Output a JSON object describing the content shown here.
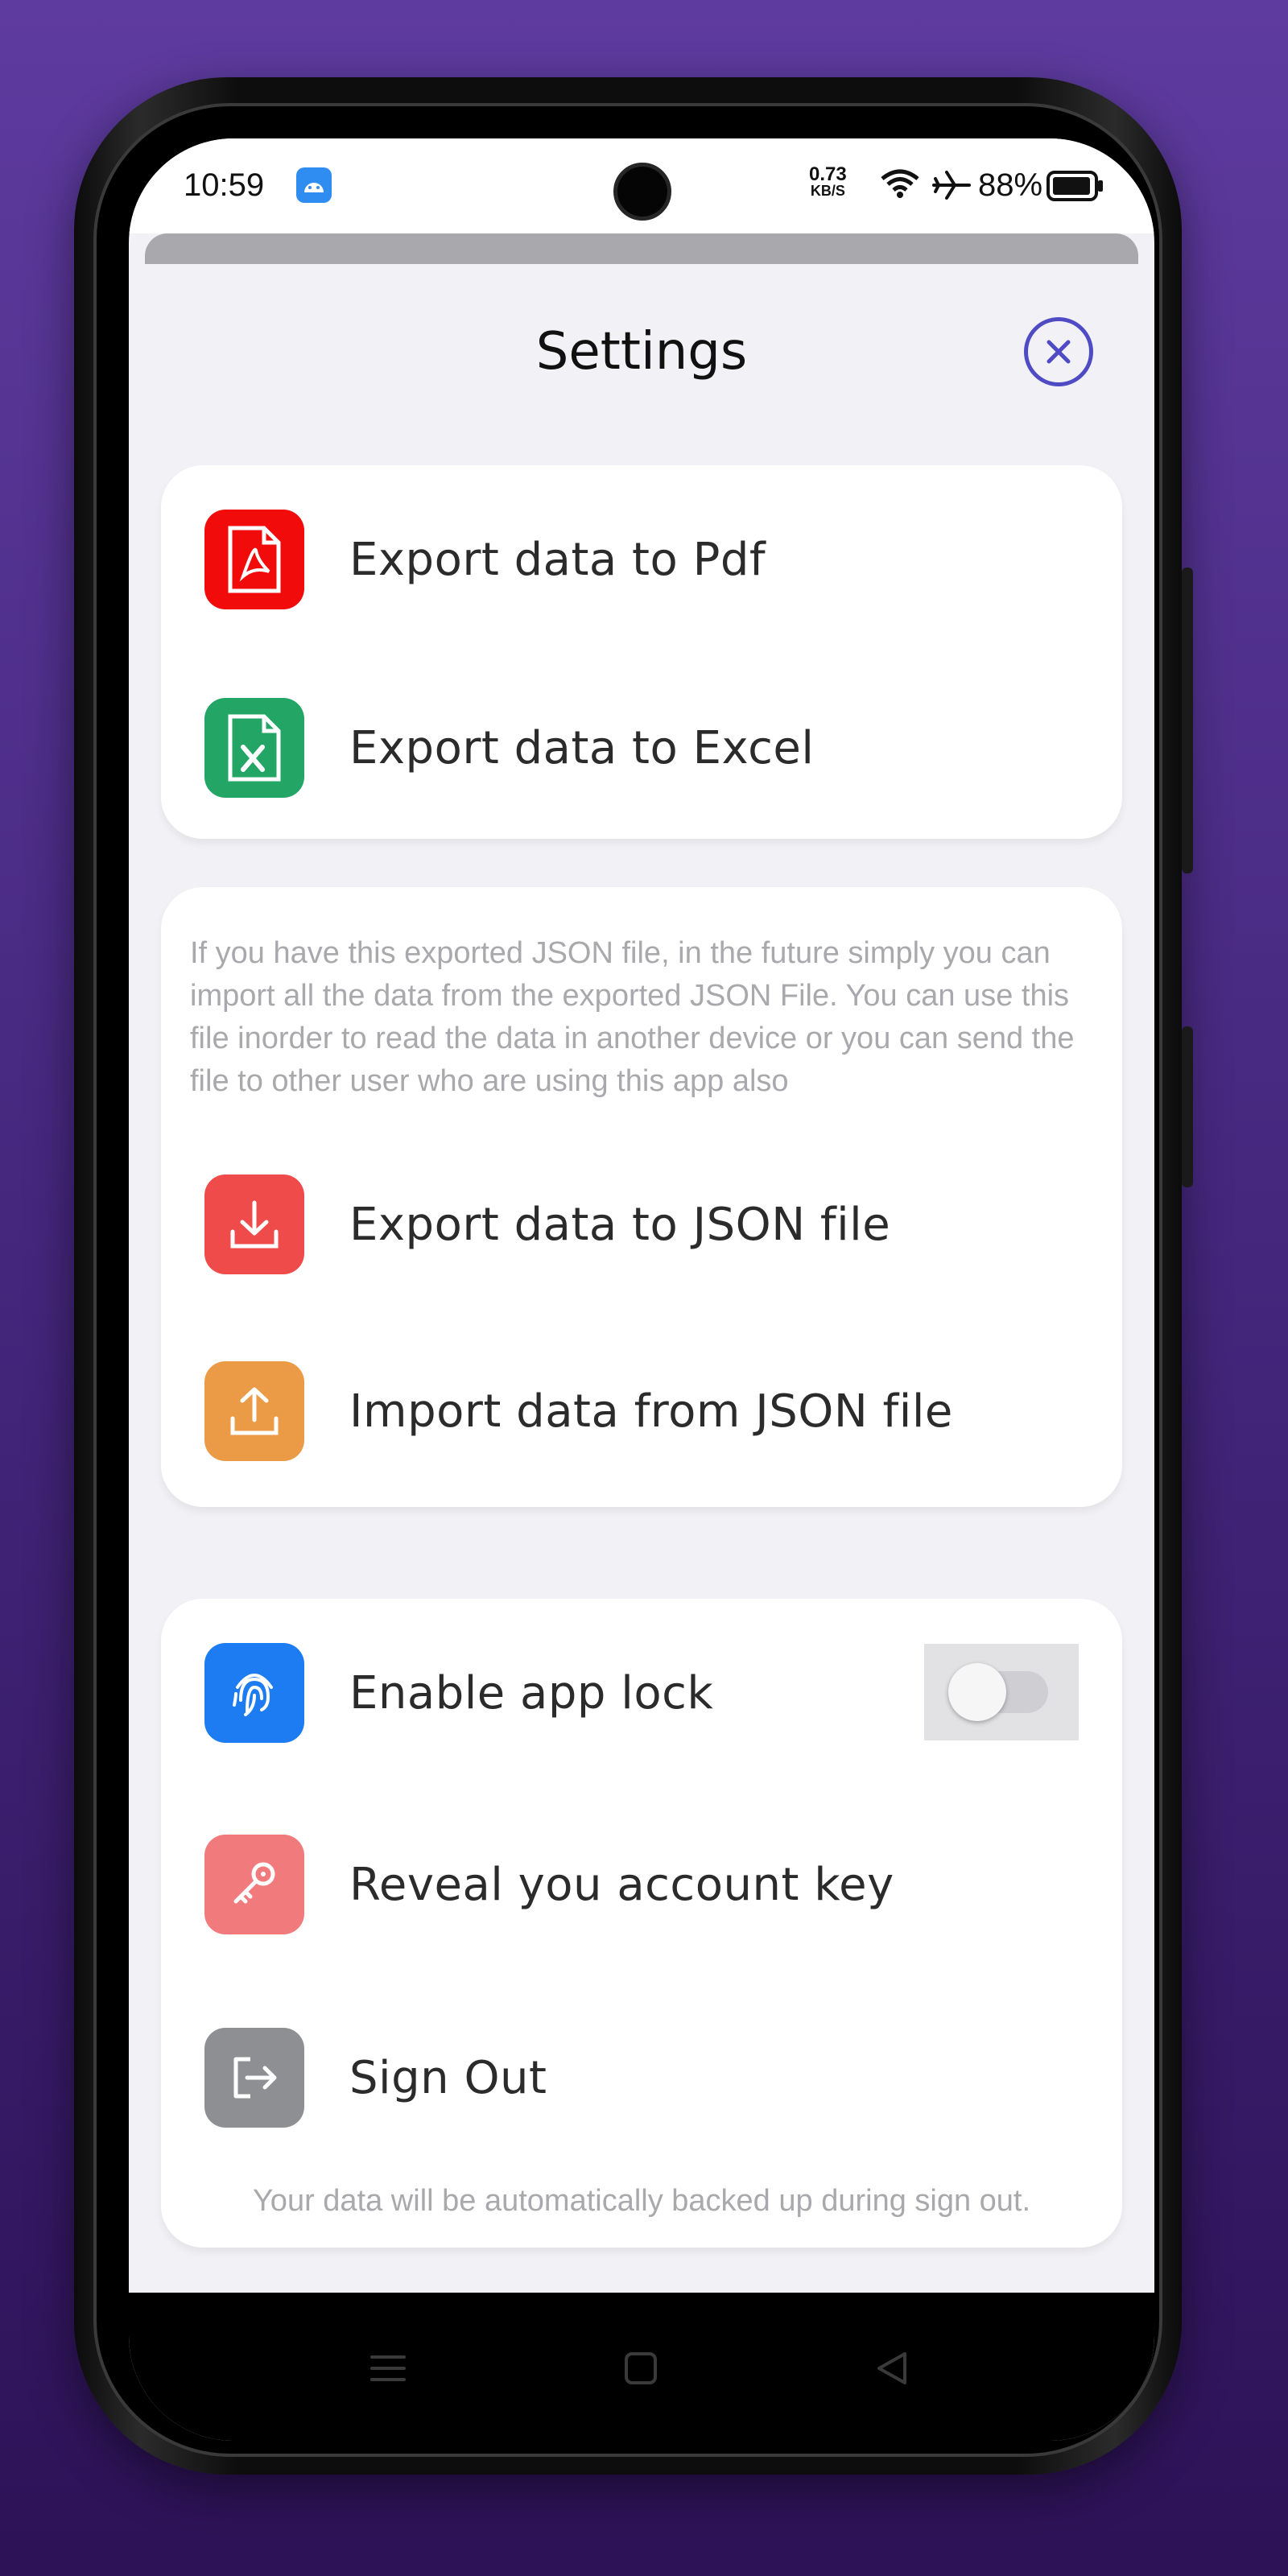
{
  "status_bar": {
    "time": "10:59",
    "net_speed_value": "0.73",
    "net_speed_unit": "KB/S",
    "battery": "88%",
    "icons": [
      "android-app-icon",
      "wifi-icon",
      "airplane-icon",
      "battery-icon"
    ]
  },
  "sheet": {
    "title": "Settings",
    "close_icon": "close-icon"
  },
  "export_section": {
    "items": [
      {
        "label": "Export data to Pdf",
        "icon": "pdf-icon",
        "color": "#f20b0b"
      },
      {
        "label": "Export data to Excel",
        "icon": "excel-icon",
        "color": "#23a566"
      }
    ]
  },
  "json_section": {
    "info": "If you have this exported JSON file, in the future simply you can import all the data from the exported JSON File. You can use this file inorder to read the data in another device or you can send the file to other user who are using this app also",
    "items": [
      {
        "label": "Export data to JSON file",
        "icon": "download-icon",
        "color": "#ef4b4b"
      },
      {
        "label": "Import data from JSON file",
        "icon": "upload-icon",
        "color": "#eb9a46"
      }
    ]
  },
  "account_section": {
    "items": [
      {
        "label": "Enable app lock",
        "icon": "fingerprint-icon",
        "color": "#1d7cf2"
      },
      {
        "label": "Reveal you account key",
        "icon": "key-icon",
        "color": "#f07a7c"
      },
      {
        "label": "Sign Out",
        "icon": "sign-out-icon",
        "color": "#8e8f93"
      }
    ],
    "app_lock_enabled": false,
    "footer_note": "Your data will be automatically backed up during sign out."
  },
  "nav_bar": {
    "icons": [
      "menu-icon",
      "home-icon",
      "back-icon"
    ]
  }
}
